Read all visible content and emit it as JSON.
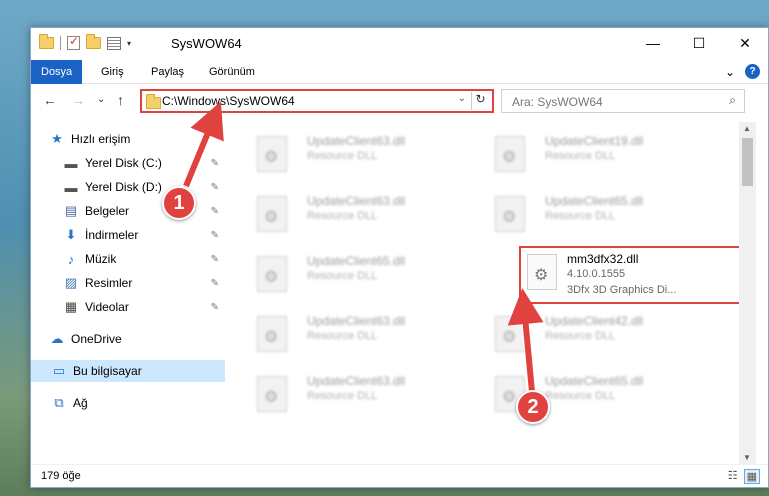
{
  "window": {
    "title": "SysWOW64",
    "controls": {
      "minimize": "—",
      "maximize": "☐",
      "close": "✕"
    }
  },
  "ribbon": {
    "tabs": [
      {
        "label": "Dosya",
        "active": true
      },
      {
        "label": "Giriş",
        "active": false
      },
      {
        "label": "Paylaş",
        "active": false
      },
      {
        "label": "Görünüm",
        "active": false
      }
    ],
    "expand": "⌄",
    "help": "?"
  },
  "nav": {
    "back": "←",
    "forward": "→",
    "recent": "⌄",
    "up": "↑",
    "address": "C:\\Windows\\SysWOW64",
    "address_chevron": "⌄",
    "refresh": "↻",
    "search_placeholder": "Ara: SysWOW64",
    "search_icon": "⌕"
  },
  "sidebar": {
    "items": [
      {
        "label": "Hızlı erişim",
        "icon": "star-icon",
        "glyph": "★",
        "pinned": false
      },
      {
        "label": "Yerel Disk (C:)",
        "icon": "drive-icon",
        "glyph": "▬",
        "pinned": true
      },
      {
        "label": "Yerel Disk (D:)",
        "icon": "drive-icon",
        "glyph": "▬",
        "pinned": true
      },
      {
        "label": "Belgeler",
        "icon": "documents-icon",
        "glyph": "▤",
        "pinned": true
      },
      {
        "label": "İndirmeler",
        "icon": "download-icon",
        "glyph": "⬇",
        "pinned": true
      },
      {
        "label": "Müzik",
        "icon": "music-icon",
        "glyph": "♪",
        "pinned": true
      },
      {
        "label": "Resimler",
        "icon": "pictures-icon",
        "glyph": "▨",
        "pinned": true
      },
      {
        "label": "Videolar",
        "icon": "video-icon",
        "glyph": "▦",
        "pinned": true
      },
      {
        "label": "OneDrive",
        "icon": "cloud-icon",
        "glyph": "☁",
        "pinned": false
      },
      {
        "label": "Bu bilgisayar",
        "icon": "computer-icon",
        "glyph": "▭",
        "pinned": false,
        "selected": true
      },
      {
        "label": "Ağ",
        "icon": "network-icon",
        "glyph": "⧉",
        "pinned": false
      }
    ],
    "pin_glyph": "📌"
  },
  "files": [
    {
      "name": "UpdateClient63.dll",
      "sub": "Resource DLL"
    },
    {
      "name": "UpdateClient19.dll",
      "sub": "Resource DLL"
    },
    {
      "name": "UpdateClient63.dll",
      "sub": "Resource DLL"
    },
    {
      "name": "UpdateClient65.dll",
      "sub": "Resource DLL"
    },
    {
      "name": "UpdateClient65.dll",
      "sub": "Resource DLL"
    },
    {
      "name": "mm3dfx32.dll",
      "sub": "4.10.0.1555",
      "sub2": "3Dfx 3D Graphics Di...",
      "highlighted": true
    },
    {
      "name": "UpdateClient63.dll",
      "sub": "Resource DLL"
    },
    {
      "name": "UpdateClient42.dll",
      "sub": "Resource DLL"
    },
    {
      "name": "UpdateClient63.dll",
      "sub": "Resource DLL"
    },
    {
      "name": "UpdateClient65.dll",
      "sub": "Resource DLL"
    }
  ],
  "status": {
    "count": "179 öğe",
    "view_details": "☷",
    "view_tiles": "▦"
  },
  "callouts": {
    "one": "1",
    "two": "2"
  },
  "colors": {
    "accent": "#1a63c4",
    "highlight": "#e0423f",
    "selected": "#cce8ff"
  }
}
